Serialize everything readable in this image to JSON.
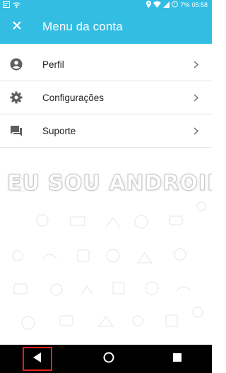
{
  "status_bar": {
    "battery": "7%",
    "time": "05:58",
    "icons": [
      "notification-icon",
      "wifi-icon",
      "location-icon",
      "signal-wifi-icon",
      "signal-icon",
      "battery-icon"
    ]
  },
  "app_bar": {
    "title": "Menu da conta",
    "close_icon": "close-icon"
  },
  "menu": {
    "items": [
      {
        "label": "Perfil",
        "icon": "account-circle-icon"
      },
      {
        "label": "Configurações",
        "icon": "gear-icon"
      },
      {
        "label": "Suporte",
        "icon": "chat-icon"
      }
    ]
  },
  "watermark": {
    "text": "EU SOU ANDROID"
  },
  "colors": {
    "primary": "#34bde3",
    "nav_highlight": "#e0201c",
    "text": "#212121"
  },
  "nav_bar": {
    "buttons": [
      "back-icon",
      "home-icon",
      "recents-icon"
    ]
  }
}
